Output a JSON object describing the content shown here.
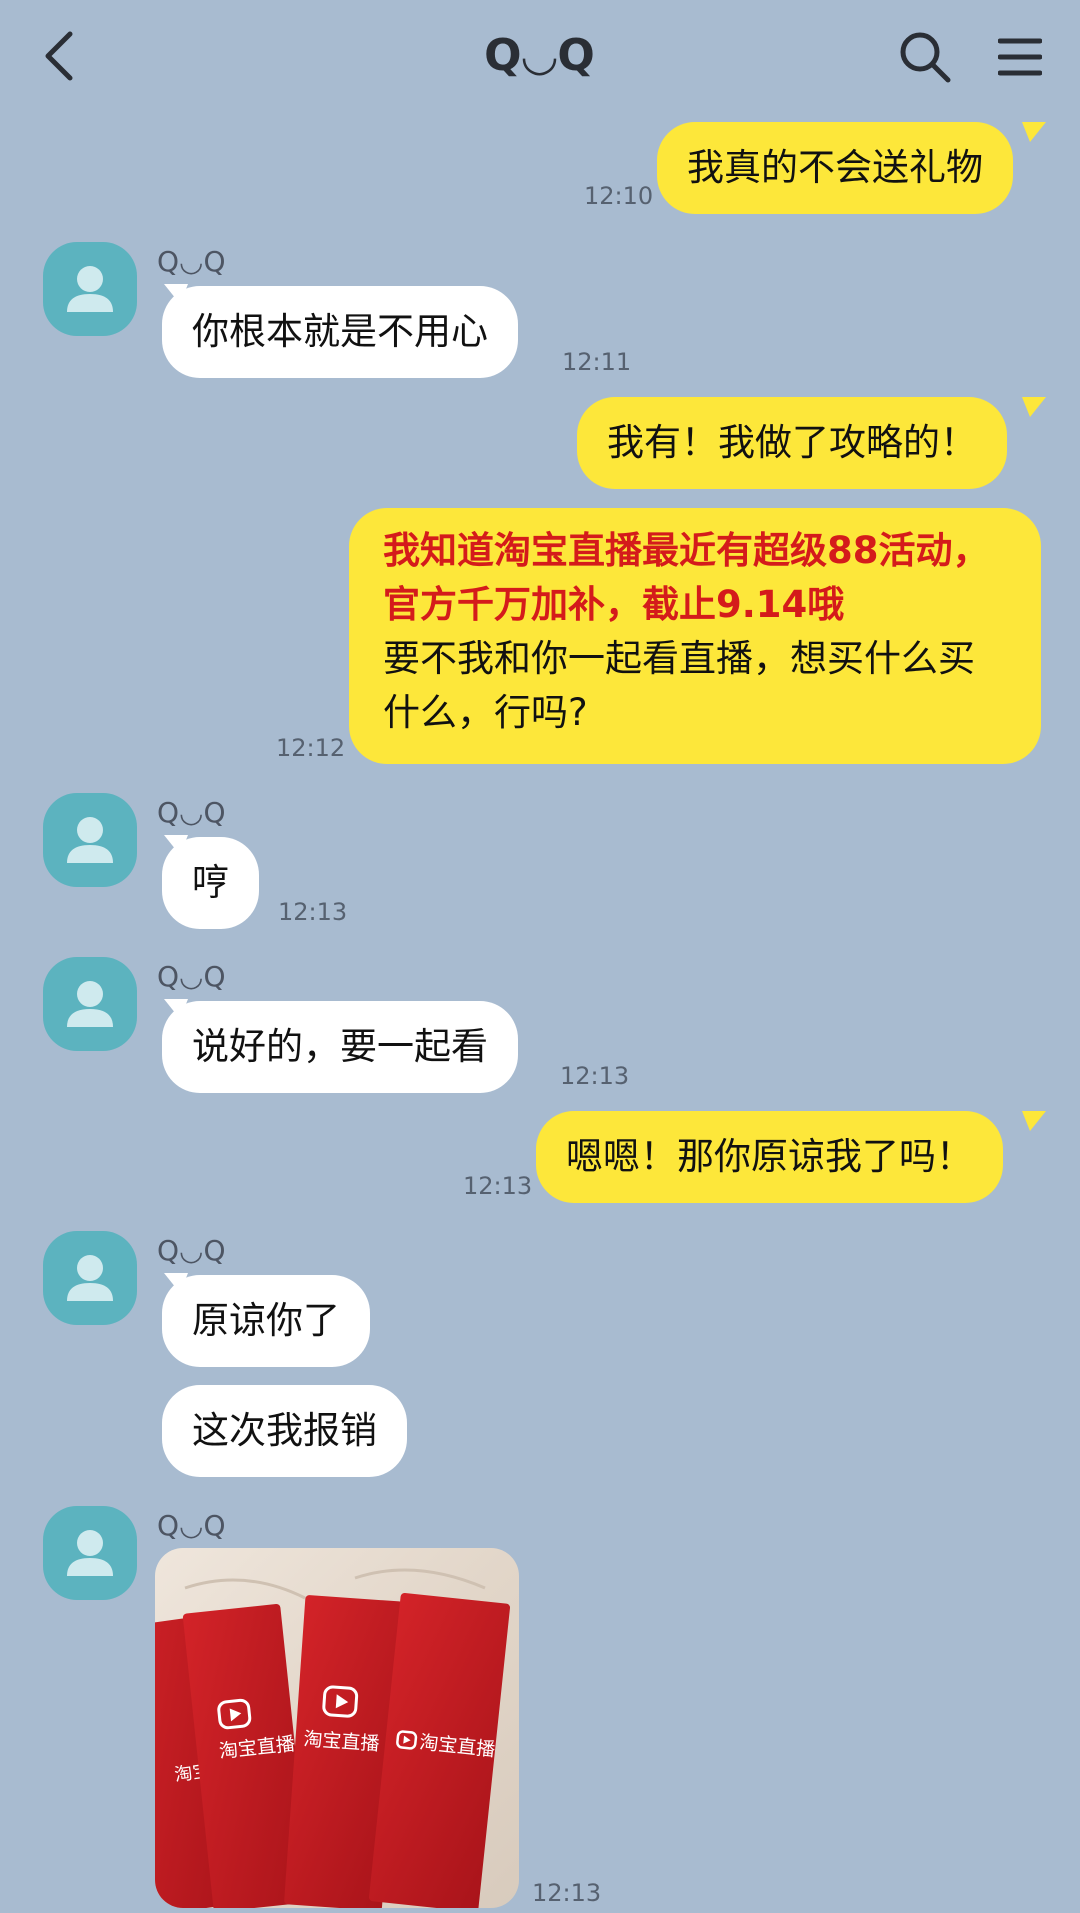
{
  "header": {
    "title": "Q◡Q",
    "back_icon": "chevron-left-icon",
    "search_icon": "search-icon",
    "menu_icon": "menu-icon"
  },
  "contact": {
    "name": "Q◡Q"
  },
  "messages": [
    {
      "from": "me",
      "text": "我真的不会送礼物",
      "time": "12:10"
    },
    {
      "from": "contact",
      "text": "你根本就是不用心",
      "time": "12:11"
    },
    {
      "from": "me",
      "text": "我有！我做了攻略的！"
    },
    {
      "from": "me",
      "highlight": "我知道淘宝直播最近有超级88活动，官方千万加补，截止9.14哦",
      "text": "要不我和你一起看直播，想买什么买什么，行吗?",
      "time": "12:12"
    },
    {
      "from": "contact",
      "text": "哼",
      "time": "12:13"
    },
    {
      "from": "contact",
      "text": "说好的，要一起看",
      "time": "12:13"
    },
    {
      "from": "me",
      "text": "嗯嗯！那你原谅我了吗！",
      "time": "12:13"
    },
    {
      "from": "contact",
      "text": "原谅你了"
    },
    {
      "from": "contact",
      "text": "这次我报销"
    },
    {
      "from": "contact",
      "type": "image",
      "image_text": "淘宝直播",
      "time": "12:13"
    }
  ],
  "colors": {
    "background": "#a8bbd0",
    "outgoing_bubble": "#fde73a",
    "incoming_bubble": "#ffffff",
    "avatar": "#5cb3bf",
    "highlight_text": "#d41b1b",
    "envelope_red": "#c8191f"
  }
}
